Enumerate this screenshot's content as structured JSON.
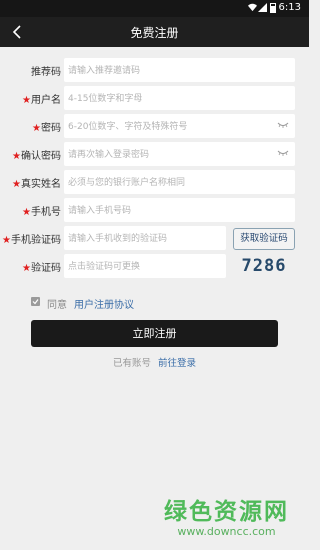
{
  "status_bar": {
    "time": "6:13"
  },
  "header": {
    "title": "免费注册"
  },
  "form": {
    "fields": [
      {
        "label": "推荐码",
        "required": false,
        "value": "",
        "placeholder": "请输入推荐邀请码"
      },
      {
        "label": "用户名",
        "required": true,
        "value": "",
        "placeholder": "4-15位数字和字母"
      },
      {
        "label": "密码",
        "required": true,
        "value": "",
        "placeholder": "6-20位数字、字符及特殊符号"
      },
      {
        "label": "确认密码",
        "required": true,
        "value": "",
        "placeholder": "请再次输入登录密码"
      },
      {
        "label": "真实姓名",
        "required": true,
        "value": "",
        "placeholder": "必须与您的银行账户名称相同"
      },
      {
        "label": "手机号",
        "required": true,
        "value": "",
        "placeholder": "请输入手机号码"
      },
      {
        "label": "手机验证码",
        "required": true,
        "value": "",
        "placeholder": "请输入手机收到的验证码"
      },
      {
        "label": "验证码",
        "required": true,
        "value": "",
        "placeholder": "点击验证码可更换"
      }
    ],
    "required_mark": "★",
    "sms_button_label": "获取验证码",
    "captcha_text": "7286",
    "agree_checked": true,
    "agree_text": "同意",
    "agreement_link": "用户注册协议",
    "submit_label": "立即注册",
    "has_account_text": "已有账号",
    "login_link": "前往登录"
  },
  "watermark": {
    "name": "绿色资源网",
    "url": "www.downcc.com"
  },
  "colors": {
    "accent_link": "#3b6ea8",
    "required_star": "#e02020",
    "button_bg": "#1a1a1a",
    "watermark": "#3fb54a"
  }
}
